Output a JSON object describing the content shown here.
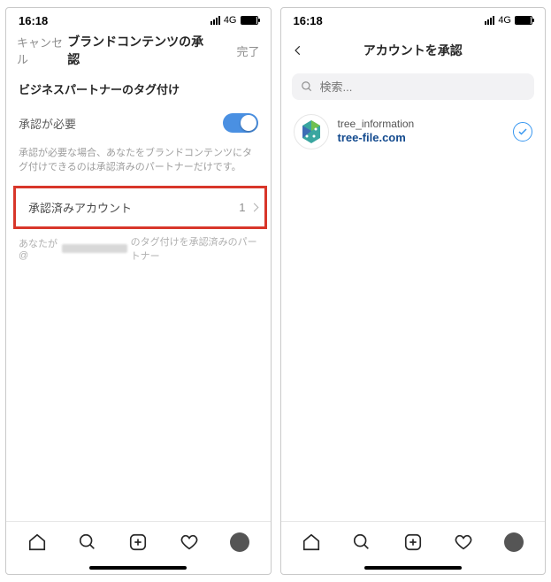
{
  "left": {
    "status": {
      "time": "16:18",
      "network": "4G"
    },
    "nav": {
      "cancel": "キャンセル",
      "title": "ブランドコンテンツの承認",
      "done": "完了"
    },
    "section_header": "ビジネスパートナーのタグ付け",
    "toggle_label": "承認が必要",
    "toggle_note": "承認が必要な場合、あなたをブランドコンテンツにタグ付けできるのは承認済みのパートナーだけです。",
    "approved_label": "承認済みアカウント",
    "approved_count": "1",
    "partner_prefix": "あなたが@",
    "partner_suffix": "のタグ付けを承認済みのパートナー"
  },
  "right": {
    "status": {
      "time": "16:18",
      "network": "4G"
    },
    "nav": {
      "title": "アカウントを承認"
    },
    "search_placeholder": "検索...",
    "account": {
      "username": "tree_information",
      "display": "tree-file.com"
    }
  }
}
